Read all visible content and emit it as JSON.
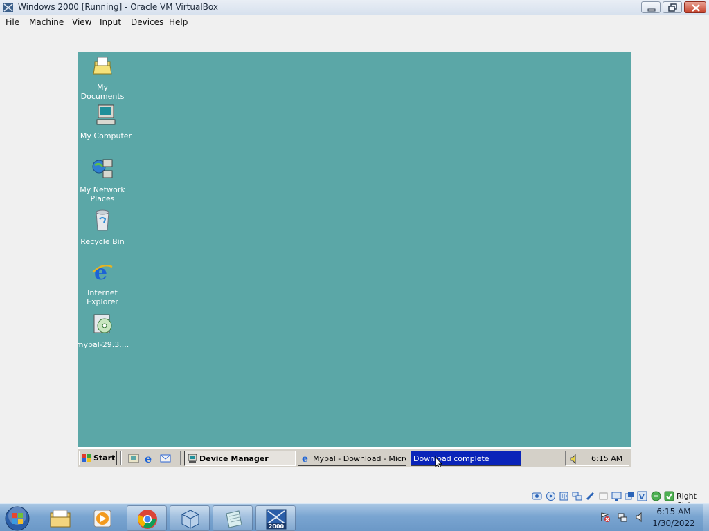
{
  "window": {
    "title": "Windows 2000 [Running] - Oracle VM VirtualBox",
    "menu": [
      "File",
      "Machine",
      "View",
      "Input",
      "Devices",
      "Help"
    ]
  },
  "guest": {
    "background_color": "#5ba7a7",
    "desktop_icons": [
      {
        "label": "My Documents",
        "icon": "folder-documents-icon"
      },
      {
        "label": "My Computer",
        "icon": "computer-icon"
      },
      {
        "label": "My Network Places",
        "icon": "network-places-icon"
      },
      {
        "label": "Recycle Bin",
        "icon": "recycle-bin-icon"
      },
      {
        "label": "Internet Explorer",
        "icon": "internet-explorer-icon"
      },
      {
        "label": "mypal-29.3....",
        "icon": "installer-cd-icon"
      }
    ],
    "taskbar": {
      "start_label": "Start",
      "quick_launch": [
        "show-desktop-icon",
        "internet-explorer-icon",
        "outlook-express-icon"
      ],
      "tasks": [
        {
          "label": "Device Manager",
          "icon": "device-manager-icon",
          "state": "active"
        },
        {
          "label": "Mypal - Download - Micro...",
          "icon": "internet-explorer-icon",
          "state": "normal"
        },
        {
          "label": "Download complete",
          "icon": "",
          "state": "alert"
        }
      ],
      "clock": "6:15 AM"
    }
  },
  "vbox_status": {
    "icons": [
      "hard-disk-icon",
      "optical-drive-icon",
      "audio-icon",
      "network-icon",
      "usb-icon",
      "shared-folders-icon",
      "display-icon",
      "video-capture-icon",
      "virtualization-icon",
      "mouse-integration-icon",
      "keyboard-icon"
    ],
    "host_key": "Right Ctrl"
  },
  "host_taskbar": {
    "pinned": [
      {
        "name": "windows-explorer-icon",
        "running": false
      },
      {
        "name": "media-player-icon",
        "running": false
      },
      {
        "name": "chrome-icon",
        "running": true
      },
      {
        "name": "virtualbox-icon",
        "running": true
      },
      {
        "name": "notepad-icon",
        "running": true
      },
      {
        "name": "windows-2000-vm-icon",
        "running": true
      }
    ],
    "vm_badge": "2000",
    "clock_time": "6:15 AM",
    "clock_date": "1/30/2022"
  }
}
